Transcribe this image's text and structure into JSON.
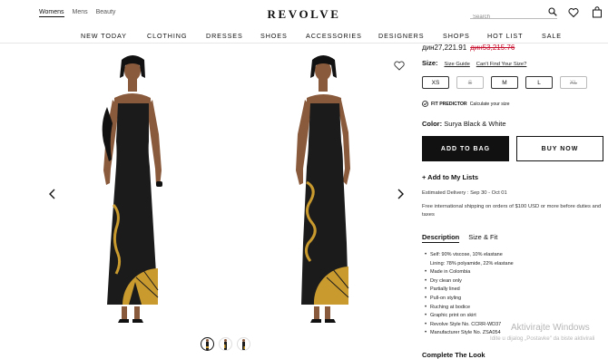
{
  "header": {
    "gender_tabs": [
      "Womens",
      "Mens",
      "Beauty"
    ],
    "logo": "REVOLVE",
    "search_placeholder": "Search"
  },
  "nav": [
    "NEW TODAY",
    "CLOTHING",
    "DRESSES",
    "SHOES",
    "ACCESSORIES",
    "DESIGNERS",
    "SHOPS",
    "HOT LIST",
    "SALE"
  ],
  "product": {
    "price_sale": "дин27,221.91",
    "price_original": "дин53,215.76",
    "size_label": "Size:",
    "size_guide": "Size Guide",
    "size_help": "Can't Find Your Size?",
    "sizes": [
      {
        "label": "XS",
        "available": true
      },
      {
        "label": "S",
        "available": false
      },
      {
        "label": "M",
        "available": true
      },
      {
        "label": "L",
        "available": true
      },
      {
        "label": "XL",
        "available": false
      }
    ],
    "fit_label": "FIT PREDICTOR",
    "fit_text": "Calculate your size",
    "color_label": "Color:",
    "color_value": "Surya Black & White",
    "add_to_bag": "ADD TO BAG",
    "buy_now": "BUY NOW",
    "add_to_lists": "+ Add to My Lists",
    "delivery": "Estimated Delivery : Sep 30 - Oct 01",
    "shipping": "Free international shipping on orders of $100 USD or more before duties and taxes",
    "tabs": [
      "Description",
      "Size & Fit"
    ],
    "description": [
      "Self: 90% viscose, 10% elastane",
      "Lining: 78% polyamide, 22% elastane",
      "Made in Colombia",
      "Dry clean only",
      "Partially lined",
      "Pull-on styling",
      "Ruching at bodice",
      "Graphic print on skirt",
      "Revolve Style No. CCRR-WD37",
      "Manufacturer Style No. ZSA054"
    ],
    "complete_the_look": "Complete The Look"
  },
  "watermark": {
    "line1": "Aktivirajte Windows",
    "line2": "Idite u dijalog „Postavke\" da biste aktivirali"
  },
  "colors": {
    "accent": "#111111",
    "sale_red": "#c8102e",
    "dress_black": "#1b1b1b",
    "print_gold": "#c99a2e",
    "skin": "#8a5a3c"
  }
}
